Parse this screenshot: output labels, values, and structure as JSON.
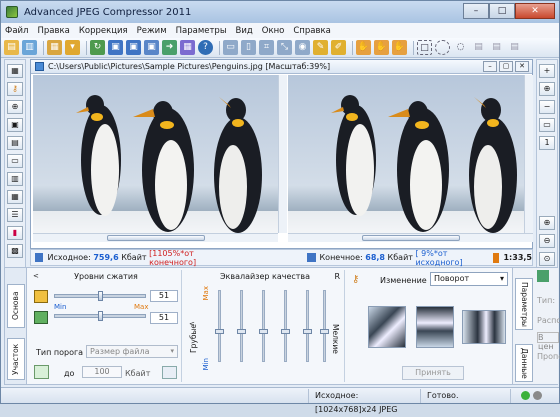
{
  "window": {
    "title": "Advanced JPEG Compressor 2011",
    "minimize": "–",
    "maximize": "□",
    "close": "✕"
  },
  "menu": [
    "Файл",
    "Правка",
    "Коррекция",
    "Режим",
    "Параметры",
    "Вид",
    "Окно",
    "Справка"
  ],
  "document": {
    "title": "C:\\Users\\Public\\Pictures\\Sample Pictures\\Penguins.jpg  [Масштаб:39%]"
  },
  "info": {
    "source_label": "Исходное:",
    "source_size": "759,6",
    "source_unit": "Кбайт",
    "source_ratio": "[1105%*от конечного]",
    "final_label": "Конечное:",
    "final_size": "68,8",
    "final_unit": "Кбайт",
    "final_ratio": "[ 9%*от исходного]",
    "time": "1:33,5"
  },
  "compression": {
    "title": "Уровни сжатия",
    "min": "Min",
    "max": "Max",
    "value1": "51",
    "value2": "51",
    "level1": 0.51,
    "level2": 0.51,
    "threshold_label": "Тип порога",
    "threshold_select": "Размер файла",
    "to_label": "до",
    "to_value": "100",
    "to_unit": "Кбайт"
  },
  "equalizer": {
    "title": "Эквалайзер качества",
    "r_label": "R",
    "coarse_label": "Грубые",
    "fine_label": "Мелкие",
    "max": "Max",
    "min": "Min",
    "arrow": "<"
  },
  "transform": {
    "change_label": "Изменение",
    "mode": "Поворот",
    "apply": "Принять"
  },
  "side_tabs": {
    "left_top": "Основа",
    "left_bottom": "Участок",
    "right_params": "Параметры",
    "right_data": "Данные",
    "right_type": "Тип:",
    "right_dist": "Распо",
    "right_inc": "В цен",
    "right_prop": "Пропо"
  },
  "status": {
    "source": "Исходное: [1024x768]x24 JPEG",
    "state": "Готово."
  },
  "colors": {
    "accent": "#2f6db5",
    "red": "#d02020",
    "blue": "#1c5fd0",
    "orange": "#e07a10"
  }
}
